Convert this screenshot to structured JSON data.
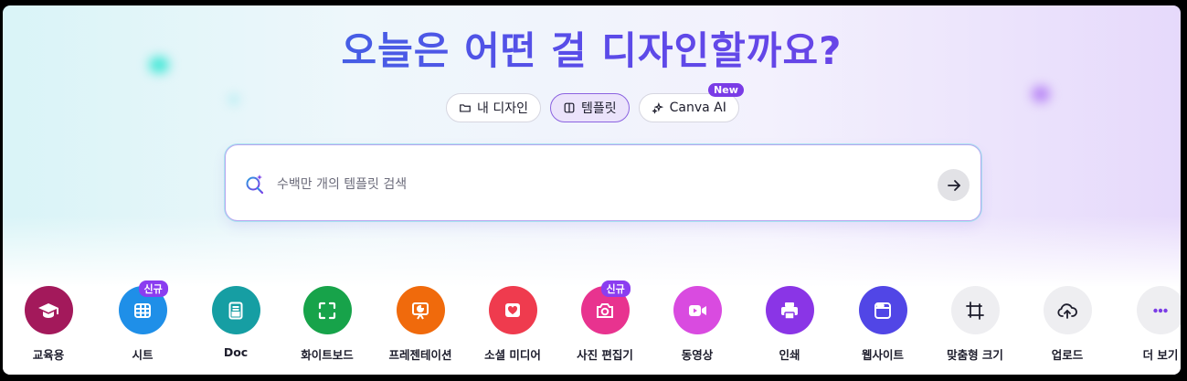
{
  "headline": "오늘은 어떤 걸 디자인할까요?",
  "tabs": [
    {
      "label": "내 디자인",
      "icon": "folder-icon",
      "active": false
    },
    {
      "label": "템플릿",
      "icon": "template-icon",
      "active": true
    },
    {
      "label": "Canva AI",
      "icon": "sparkle-icon",
      "active": false,
      "badge": "New"
    }
  ],
  "search": {
    "placeholder": "수백만 개의 템플릿 검색",
    "value": ""
  },
  "categories": [
    {
      "label": "교육용",
      "icon": "graduation-cap-icon",
      "color": "#a3195b"
    },
    {
      "label": "시트",
      "icon": "sheet-icon",
      "color": "#1f8fe8",
      "badge": "신규"
    },
    {
      "label": "Doc",
      "icon": "doc-icon",
      "color": "#169ea3"
    },
    {
      "label": "화이트보드",
      "icon": "whiteboard-icon",
      "color": "#17a34a"
    },
    {
      "label": "프레젠테이션",
      "icon": "presentation-icon",
      "color": "#f06a0c"
    },
    {
      "label": "소셜 미디어",
      "icon": "heart-icon",
      "color": "#ef3b4e"
    },
    {
      "label": "사진 편집기",
      "icon": "camera-icon",
      "color": "#e8338f",
      "badge": "신규"
    },
    {
      "label": "동영상",
      "icon": "video-icon",
      "color": "#d94be0"
    },
    {
      "label": "인쇄",
      "icon": "printer-icon",
      "color": "#8a35e6"
    },
    {
      "label": "웹사이트",
      "icon": "website-icon",
      "color": "#5146e6"
    },
    {
      "label": "맞춤형 크기",
      "icon": "custom-size-icon",
      "color": "#eeeef1"
    },
    {
      "label": "업로드",
      "icon": "upload-cloud-icon",
      "color": "#eeeef1"
    },
    {
      "label": "더 보기",
      "icon": "more-icon",
      "color": "#eeeef1"
    }
  ]
}
